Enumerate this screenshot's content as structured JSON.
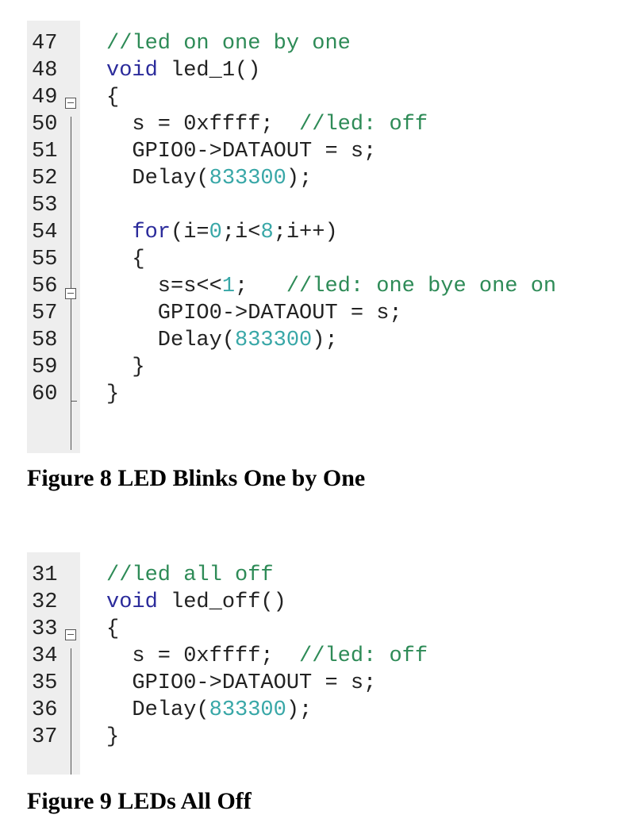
{
  "figures": [
    {
      "caption": "Figure 8 LED Blinks One by One",
      "lines": [
        {
          "num": "47",
          "tokens": [
            {
              "t": "//led on one by one",
              "k": "comment"
            }
          ]
        },
        {
          "num": "48",
          "tokens": [
            {
              "t": "void",
              "k": "keyword"
            },
            {
              "t": " led_1()",
              "k": "plain"
            }
          ]
        },
        {
          "num": "49",
          "tokens": [
            {
              "t": "{",
              "k": "plain"
            }
          ]
        },
        {
          "num": "50",
          "tokens": [
            {
              "t": "  s = 0xffff;  ",
              "k": "plain"
            },
            {
              "t": "//led: off",
              "k": "comment"
            }
          ]
        },
        {
          "num": "51",
          "tokens": [
            {
              "t": "  GPIO0->DATAOUT = s;",
              "k": "plain"
            }
          ]
        },
        {
          "num": "52",
          "tokens": [
            {
              "t": "  Delay(",
              "k": "plain"
            },
            {
              "t": "833300",
              "k": "number"
            },
            {
              "t": ");",
              "k": "plain"
            }
          ]
        },
        {
          "num": "53",
          "tokens": []
        },
        {
          "num": "54",
          "tokens": [
            {
              "t": "  ",
              "k": "plain"
            },
            {
              "t": "for",
              "k": "keyword"
            },
            {
              "t": "(i=",
              "k": "plain"
            },
            {
              "t": "0",
              "k": "number"
            },
            {
              "t": ";i<",
              "k": "plain"
            },
            {
              "t": "8",
              "k": "number"
            },
            {
              "t": ";i++)",
              "k": "plain"
            }
          ]
        },
        {
          "num": "55",
          "tokens": [
            {
              "t": "  {",
              "k": "plain"
            }
          ]
        },
        {
          "num": "56",
          "tokens": [
            {
              "t": "    s=s<<",
              "k": "plain"
            },
            {
              "t": "1",
              "k": "number"
            },
            {
              "t": ";   ",
              "k": "plain"
            },
            {
              "t": "//led: one bye one on",
              "k": "comment"
            }
          ]
        },
        {
          "num": "57",
          "tokens": [
            {
              "t": "    GPIO0->DATAOUT = s;",
              "k": "plain"
            }
          ]
        },
        {
          "num": "58",
          "tokens": [
            {
              "t": "    Delay(",
              "k": "plain"
            },
            {
              "t": "833300",
              "k": "number"
            },
            {
              "t": ");",
              "k": "plain"
            }
          ]
        },
        {
          "num": "59",
          "tokens": [
            {
              "t": "  }",
              "k": "plain"
            }
          ]
        },
        {
          "num": "60",
          "tokens": [
            {
              "t": "}",
              "k": "plain"
            }
          ]
        }
      ]
    },
    {
      "caption": "Figure 9 LEDs All Off",
      "lines": [
        {
          "num": "31",
          "tokens": [
            {
              "t": "//led all off",
              "k": "comment"
            }
          ]
        },
        {
          "num": "32",
          "tokens": [
            {
              "t": "void",
              "k": "keyword"
            },
            {
              "t": " led_off()",
              "k": "plain"
            }
          ]
        },
        {
          "num": "33",
          "tokens": [
            {
              "t": "{",
              "k": "plain"
            }
          ]
        },
        {
          "num": "34",
          "tokens": [
            {
              "t": "  s = 0xffff;  ",
              "k": "plain"
            },
            {
              "t": "//led: off",
              "k": "comment"
            }
          ]
        },
        {
          "num": "35",
          "tokens": [
            {
              "t": "  GPIO0->DATAOUT = s;",
              "k": "plain"
            }
          ]
        },
        {
          "num": "36",
          "tokens": [
            {
              "t": "  Delay(",
              "k": "plain"
            },
            {
              "t": "833300",
              "k": "number"
            },
            {
              "t": ");",
              "k": "plain"
            }
          ]
        },
        {
          "num": "37",
          "tokens": [
            {
              "t": "}",
              "k": "plain"
            }
          ]
        }
      ]
    }
  ],
  "colors": {
    "comment": "#2e8b57",
    "keyword": "#2b2b9b",
    "number": "#38a7a7",
    "plain": "#222222",
    "gutter": "#eeeeee"
  }
}
